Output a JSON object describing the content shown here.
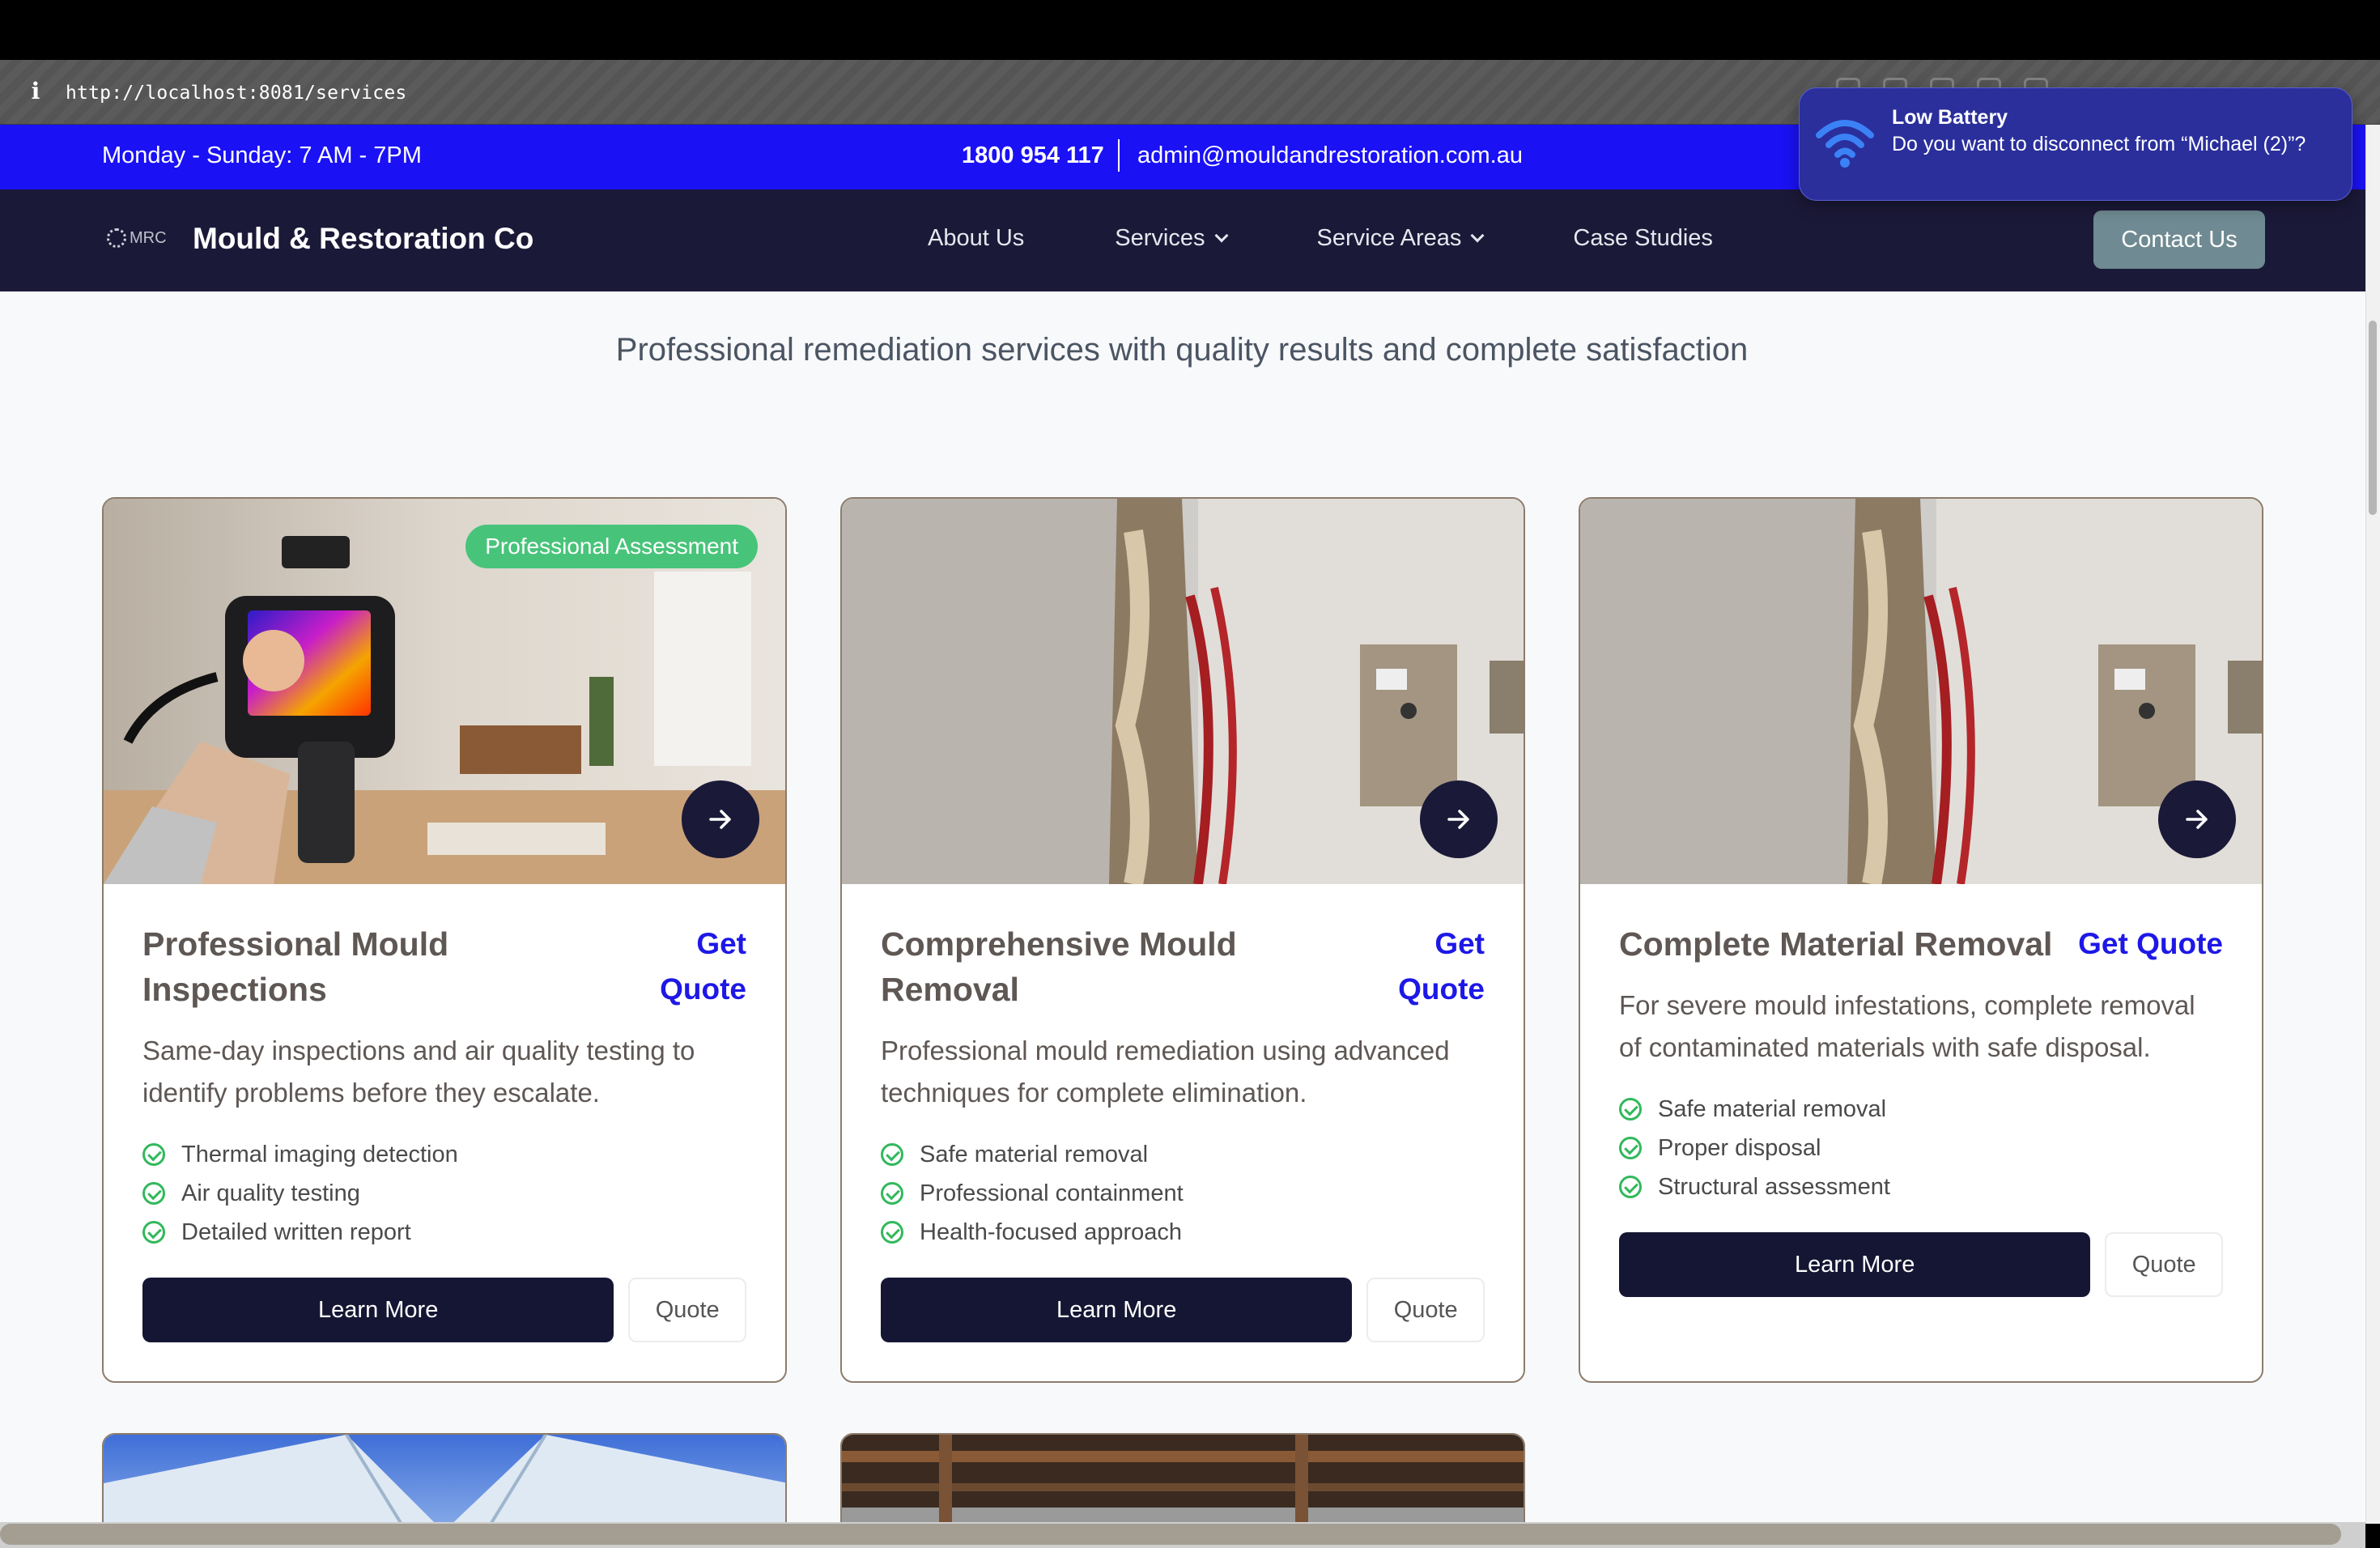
{
  "browser": {
    "url": "http://localhost:8081/services"
  },
  "utility_bar": {
    "hours": "Monday - Sunday: 7 AM - 7PM",
    "phone": "1800 954 117",
    "email": "admin@mouldandrestoration.com.au"
  },
  "nav": {
    "logo_text": "MRC",
    "brand": "Mould & Restoration Co",
    "links": [
      {
        "label": "About Us"
      },
      {
        "label": "Services"
      },
      {
        "label": "Service Areas"
      },
      {
        "label": "Case Studies"
      }
    ],
    "contact_label": "Contact Us"
  },
  "hero": {
    "subtitle": "Professional remediation services with quality results and complete satisfaction"
  },
  "cards": [
    {
      "title": "Professional Mould Inspections",
      "get_quote": "Get Quote",
      "badge": "Professional Assessment",
      "description": "Same-day inspections and air quality testing to identify problems before they escalate.",
      "features": [
        "Thermal imaging detection",
        "Air quality testing",
        "Detailed written report"
      ],
      "learn_more": "Learn More",
      "quote": "Quote"
    },
    {
      "title": "Comprehensive Mould Removal",
      "get_quote": "Get Quote",
      "description": "Professional mould remediation using advanced techniques for complete elimination.",
      "features": [
        "Safe material removal",
        "Professional containment",
        "Health-focused approach"
      ],
      "learn_more": "Learn More",
      "quote": "Quote"
    },
    {
      "title": "Complete Material Removal",
      "get_quote": "Get Quote",
      "description": "For severe mould infestations, complete removal of contaminated materials with safe disposal.",
      "features": [
        "Safe material removal",
        "Proper disposal",
        "Structural assessment"
      ],
      "learn_more": "Learn More",
      "quote": "Quote"
    }
  ],
  "notification": {
    "title": "Low Battery",
    "body": "Do you want to disconnect from “Michael (2)”?"
  }
}
